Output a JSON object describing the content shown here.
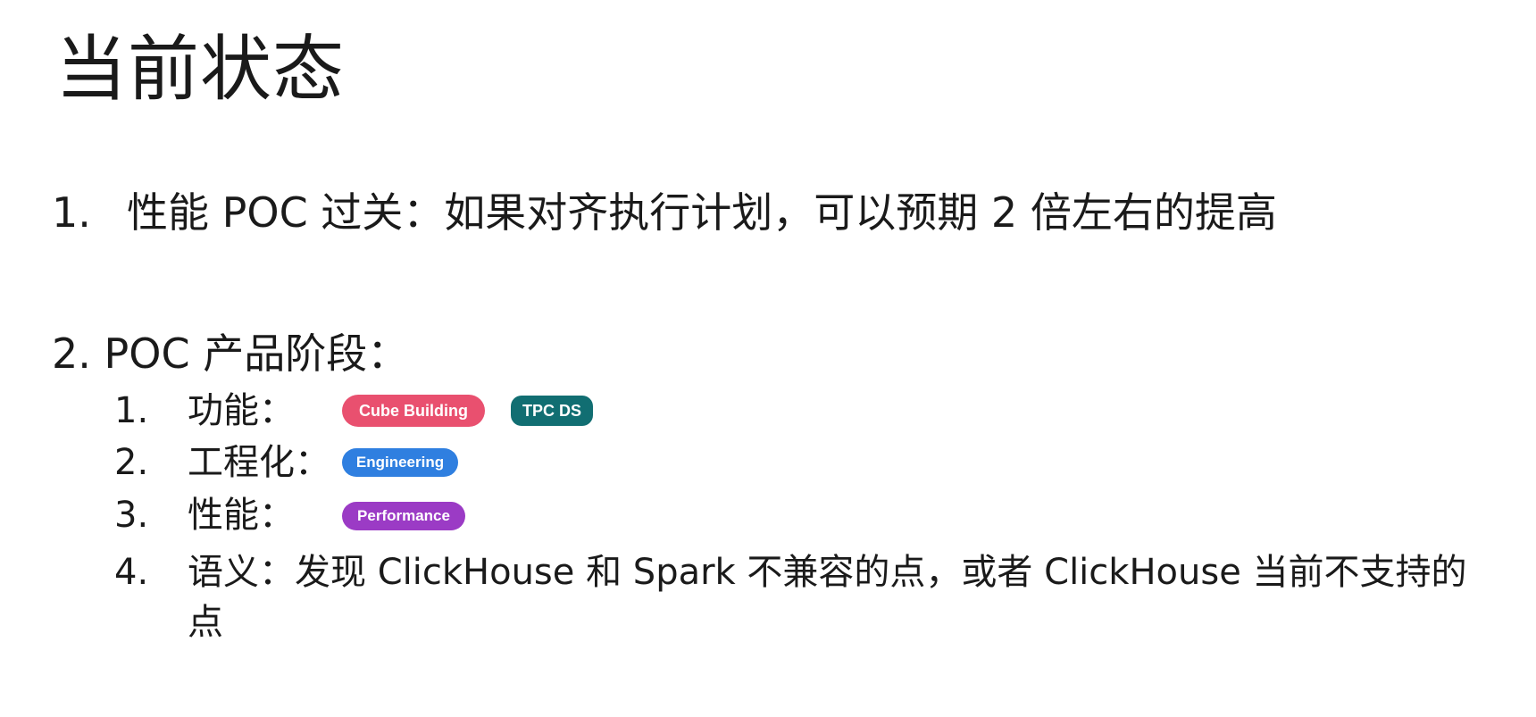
{
  "slide": {
    "title": "当前状态",
    "item1": {
      "number": "1.",
      "text": "性能 POC 过关：如果对齐执行计划，可以预期 2 倍左右的提高"
    },
    "item2": {
      "text": "2. POC 产品阶段："
    },
    "subitems": [
      {
        "number": "1.",
        "label": "功能："
      },
      {
        "number": "2.",
        "label": "工程化："
      },
      {
        "number": "3.",
        "label": "性能："
      },
      {
        "number": "4.",
        "label": "语义：发现 ClickHouse 和 Spark 不兼容的点，或者 ClickHouse 当前不支持的点"
      }
    ],
    "badges": {
      "cube_building": "Cube Building",
      "tpc_ds": "TPC DS",
      "engineering": "Engineering",
      "performance": "Performance"
    },
    "colors": {
      "cube_building": "#e9506f",
      "tpc_ds": "#116e72",
      "engineering": "#2f7fe0",
      "performance": "#9b3bc5"
    }
  }
}
